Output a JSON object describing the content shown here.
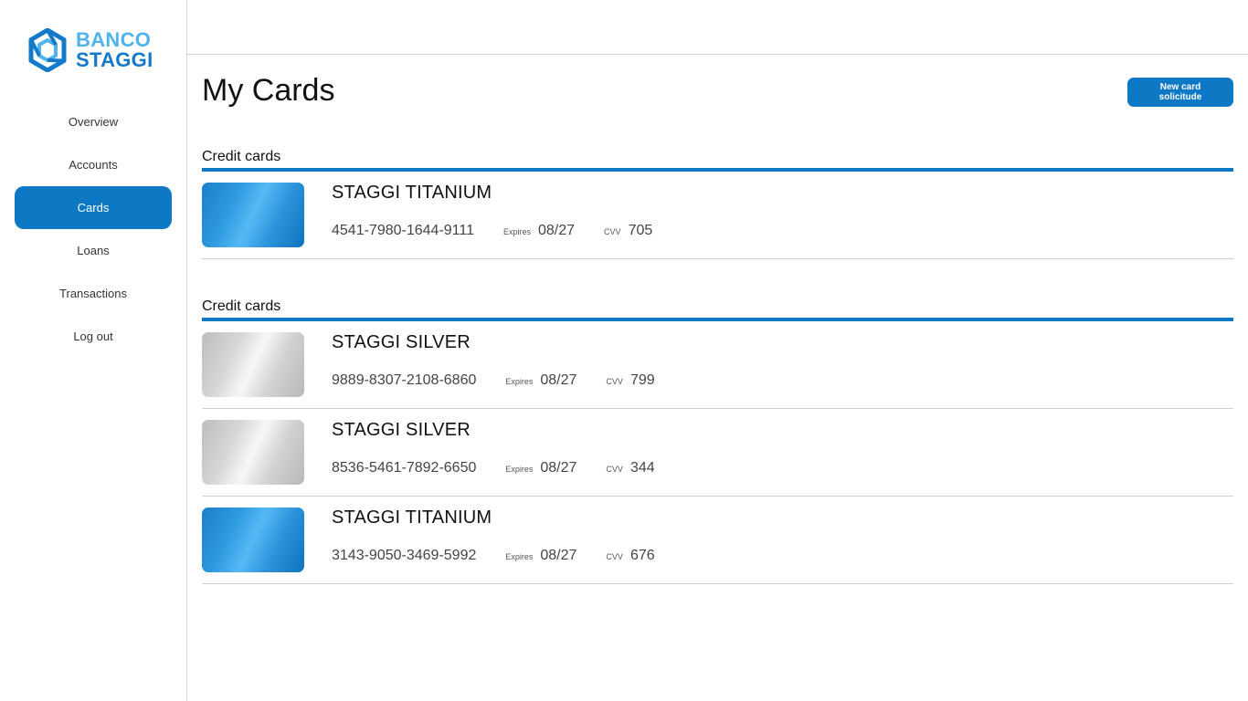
{
  "brand": {
    "line1": "BANCO",
    "line2": "STAGGI"
  },
  "sidebar": {
    "items": [
      {
        "label": "Overview"
      },
      {
        "label": "Accounts"
      },
      {
        "label": "Cards"
      },
      {
        "label": "Loans"
      },
      {
        "label": "Transactions"
      },
      {
        "label": "Log out"
      }
    ],
    "active": "Cards"
  },
  "main": {
    "title": "My Cards",
    "new_card_button": "New card solicitude",
    "sections": [
      {
        "title": "Credit cards",
        "cards": [
          {
            "name": "STAGGI TITANIUM",
            "number": "4541-7980-1644-9111",
            "expires_label": "Expires",
            "expires": "08/27",
            "cvv_label": "CVV",
            "cvv": "705",
            "style": "titanium"
          }
        ]
      },
      {
        "title": "Credit cards",
        "cards": [
          {
            "name": "STAGGI SILVER",
            "number": "9889-8307-2108-6860",
            "expires_label": "Expires",
            "expires": "08/27",
            "cvv_label": "CVV",
            "cvv": "799",
            "style": "silver"
          },
          {
            "name": "STAGGI SILVER",
            "number": "8536-5461-7892-6650",
            "expires_label": "Expires",
            "expires": "08/27",
            "cvv_label": "CVV",
            "cvv": "344",
            "style": "silver"
          },
          {
            "name": "STAGGI TITANIUM",
            "number": "3143-9050-3469-5992",
            "expires_label": "Expires",
            "expires": "08/27",
            "cvv_label": "CVV",
            "cvv": "676",
            "style": "titanium"
          }
        ]
      }
    ]
  },
  "colors": {
    "accent": "#0d78c4",
    "logo_light": "#4fb3ee",
    "logo_dark": "#1479c9",
    "titanium_card": "#2e9ae0",
    "silver_card": "#d6d6d6"
  }
}
